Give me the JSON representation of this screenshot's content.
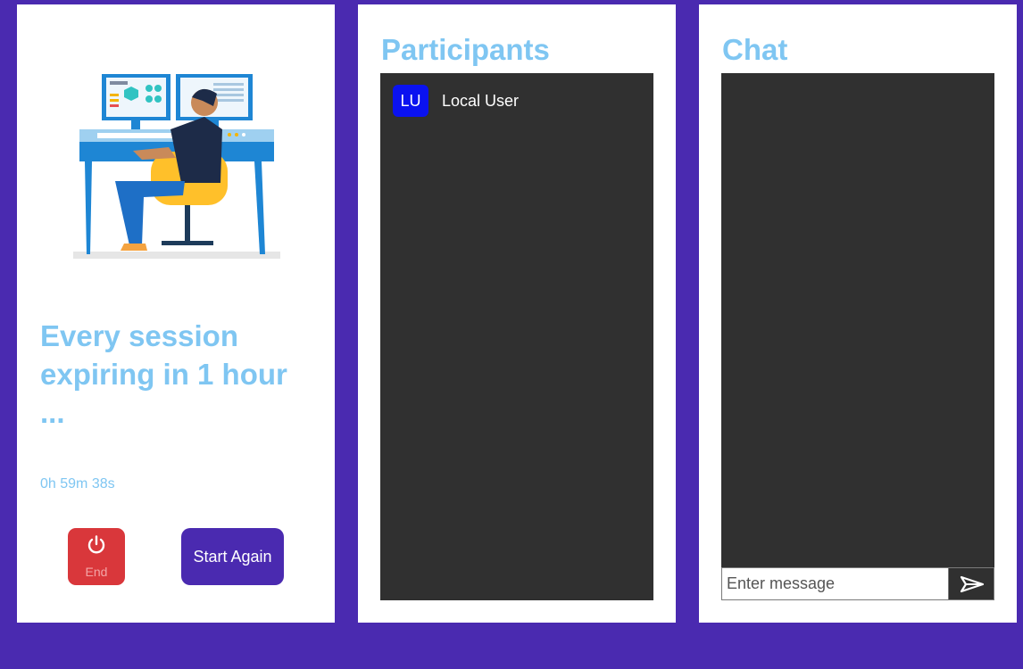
{
  "session": {
    "heading": "Every session expiring in 1 hour ...",
    "timer": "0h 59m 38s",
    "end_label": "End",
    "start_again_label": "Start Again",
    "end_icon": "power-icon",
    "illustration": "developer-at-desk-illustration"
  },
  "participants": {
    "title": "Participants",
    "items": [
      {
        "initials": "LU",
        "name": "Local User"
      }
    ]
  },
  "chat": {
    "title": "Chat",
    "input_placeholder": "Enter message",
    "input_value": "",
    "send_icon": "send-icon"
  },
  "colors": {
    "background": "#4a2ab0",
    "title": "#7fc6f2",
    "dark_panel": "#303030",
    "end_button": "#d9373b",
    "avatar": "#0a12f0"
  }
}
